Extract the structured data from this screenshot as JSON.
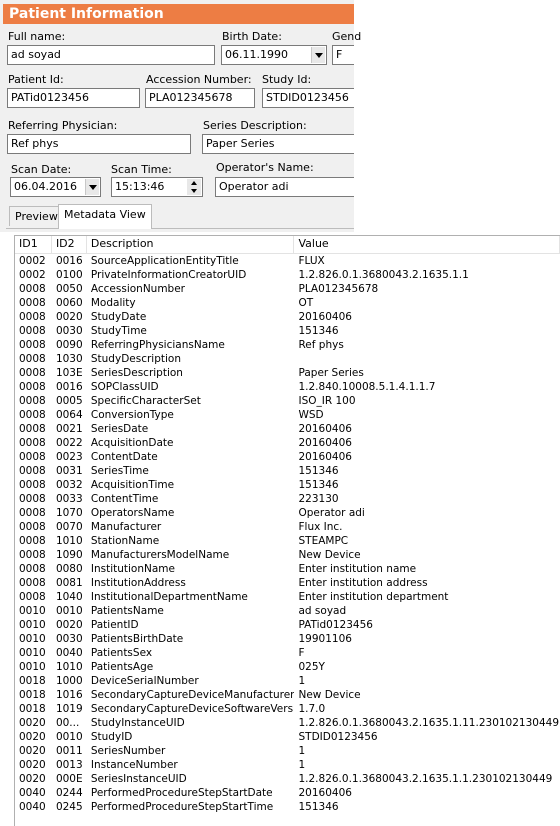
{
  "window": {
    "title": "Patient Information"
  },
  "form": {
    "full_name": {
      "label": "Full name:",
      "value": "ad soyad"
    },
    "birth_date": {
      "label": "Birth Date:",
      "value": "06.11.1990"
    },
    "gender": {
      "label": "Gend",
      "value": "F"
    },
    "patient_id": {
      "label": "Patient Id:",
      "value": "PATid0123456"
    },
    "accession_number": {
      "label": "Accession Number:",
      "value": "PLA012345678"
    },
    "study_id": {
      "label": "Study Id:",
      "value": "STDID0123456"
    },
    "referring_physician": {
      "label": "Referring Physician:",
      "value": "Ref phys"
    },
    "series_description": {
      "label": "Series Description:",
      "value": "Paper Series"
    },
    "scan_date": {
      "label": "Scan Date:",
      "value": "06.04.2016"
    },
    "scan_time": {
      "label": "Scan Time:",
      "value": "15:13:46"
    },
    "operators_name": {
      "label": "Operator's Name:",
      "value": "Operator adi"
    }
  },
  "tabs": [
    {
      "label": "Preview",
      "active": false
    },
    {
      "label": "Metadata View",
      "active": true
    }
  ],
  "grid": {
    "columns": [
      "ID1",
      "ID2",
      "Description",
      "Value"
    ],
    "rows": [
      [
        "0002",
        "0016",
        "SourceApplicationEntityTitle",
        "FLUX"
      ],
      [
        "0002",
        "0100",
        "PrivateInformationCreatorUID",
        "1.2.826.0.1.3680043.2.1635.1.1"
      ],
      [
        "0008",
        "0050",
        "AccessionNumber",
        "PLA012345678"
      ],
      [
        "0008",
        "0060",
        "Modality",
        "OT"
      ],
      [
        "0008",
        "0020",
        "StudyDate",
        "20160406"
      ],
      [
        "0008",
        "0030",
        "StudyTime",
        "151346"
      ],
      [
        "0008",
        "0090",
        "ReferringPhysiciansName",
        "Ref phys"
      ],
      [
        "0008",
        "1030",
        "StudyDescription",
        ""
      ],
      [
        "0008",
        "103E",
        "SeriesDescription",
        "Paper Series"
      ],
      [
        "0008",
        "0016",
        "SOPClassUID",
        "1.2.840.10008.5.1.4.1.1.7"
      ],
      [
        "0008",
        "0005",
        "SpecificCharacterSet",
        "ISO_IR 100"
      ],
      [
        "0008",
        "0064",
        "ConversionType",
        "WSD"
      ],
      [
        "0008",
        "0021",
        "SeriesDate",
        "20160406"
      ],
      [
        "0008",
        "0022",
        "AcquisitionDate",
        "20160406"
      ],
      [
        "0008",
        "0023",
        "ContentDate",
        "20160406"
      ],
      [
        "0008",
        "0031",
        "SeriesTime",
        "151346"
      ],
      [
        "0008",
        "0032",
        "AcquisitionTime",
        "151346"
      ],
      [
        "0008",
        "0033",
        "ContentTime",
        "223130"
      ],
      [
        "0008",
        "1070",
        "OperatorsName",
        "Operator adi"
      ],
      [
        "0008",
        "0070",
        "Manufacturer",
        "Flux Inc."
      ],
      [
        "0008",
        "1010",
        "StationName",
        "STEAMPC"
      ],
      [
        "0008",
        "1090",
        "ManufacturersModelName",
        "New Device"
      ],
      [
        "0008",
        "0080",
        "InstitutionName",
        "Enter institution name"
      ],
      [
        "0008",
        "0081",
        "InstitutionAddress",
        "Enter institution address"
      ],
      [
        "0008",
        "1040",
        "InstitutionalDepartmentName",
        "Enter institution department"
      ],
      [
        "0010",
        "0010",
        "PatientsName",
        "ad soyad"
      ],
      [
        "0010",
        "0020",
        "PatientID",
        "PATid0123456"
      ],
      [
        "0010",
        "0030",
        "PatientsBirthDate",
        "19901106"
      ],
      [
        "0010",
        "0040",
        "PatientsSex",
        "F"
      ],
      [
        "0010",
        "1010",
        "PatientsAge",
        "025Y"
      ],
      [
        "0018",
        "1000",
        "DeviceSerialNumber",
        "1"
      ],
      [
        "0018",
        "1016",
        "SecondaryCaptureDeviceManufacturersM",
        "New Device"
      ],
      [
        "0018",
        "1019",
        "SecondaryCaptureDeviceSoftwareVersion",
        "1.7.0"
      ],
      [
        "0020",
        "00...",
        "StudyInstanceUID",
        "1.2.826.0.1.3680043.2.1635.1.11.230102130449"
      ],
      [
        "0020",
        "0010",
        "StudyID",
        "STDID0123456"
      ],
      [
        "0020",
        "0011",
        "SeriesNumber",
        "1"
      ],
      [
        "0020",
        "0013",
        "InstanceNumber",
        "1"
      ],
      [
        "0020",
        "000E",
        "SeriesInstanceUID",
        "1.2.826.0.1.3680043.2.1635.1.1.230102130449"
      ],
      [
        "0040",
        "0244",
        "PerformedProcedureStepStartDate",
        "20160406"
      ],
      [
        "0040",
        "0245",
        "PerformedProcedureStepStartTime",
        "151346"
      ]
    ]
  }
}
